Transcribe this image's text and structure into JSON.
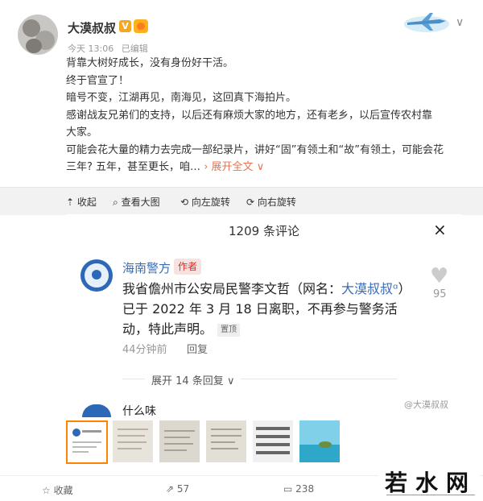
{
  "post": {
    "username": "大漠叔叔",
    "badge": "V",
    "time": "今天 13:06",
    "edited": "已编辑",
    "lines": [
      "背靠大树好成长，没有身份好干活。",
      "终于官宣了！",
      "暗号不变，江湖再见，南海见，这回真下海拍片。",
      "感谢战友兄弟们的支持，以后还有麻烦大家的地方，还有老乡，以后宣传农村靠",
      "大家。",
      "可能会花大量的精力去完成一部纪录片，讲好“固”有领土和“故”有领土，可能会花",
      "三年? 五年，甚至更长，咱…"
    ],
    "expand_full": "展开全文",
    "expand_icon": "chevron-down-icon"
  },
  "toolbar": {
    "collect": "收起",
    "view_large": "查看大图",
    "rotate_left": "向左旋转",
    "rotate_right": "向右旋转"
  },
  "comments": {
    "title": "1209 条评论",
    "close": "×",
    "top_comment": {
      "author": "海南警方",
      "author_tag": "作者",
      "text_before": "我省儋州市公安局民警李文哲（网名：",
      "link": "大漠叔叔",
      "text_after": "）已于 2022 年 3 月 18 日离职，不再参与警务活动，特此声明。",
      "pinned": "置顶",
      "likes": "95",
      "time": "44分钟前",
      "reply": "回复"
    },
    "expand_replies": "展开 14 条回复",
    "next_preview": "什么味",
    "watermark": "@大漠叔叔"
  },
  "bottom": {
    "favorite": "收藏",
    "repost_count": "57",
    "comment_count": "238"
  },
  "site_logo": "若水网",
  "colors": {
    "accent": "#ff8200",
    "link": "#eb7350",
    "police_blue": "#3a6bb2"
  }
}
